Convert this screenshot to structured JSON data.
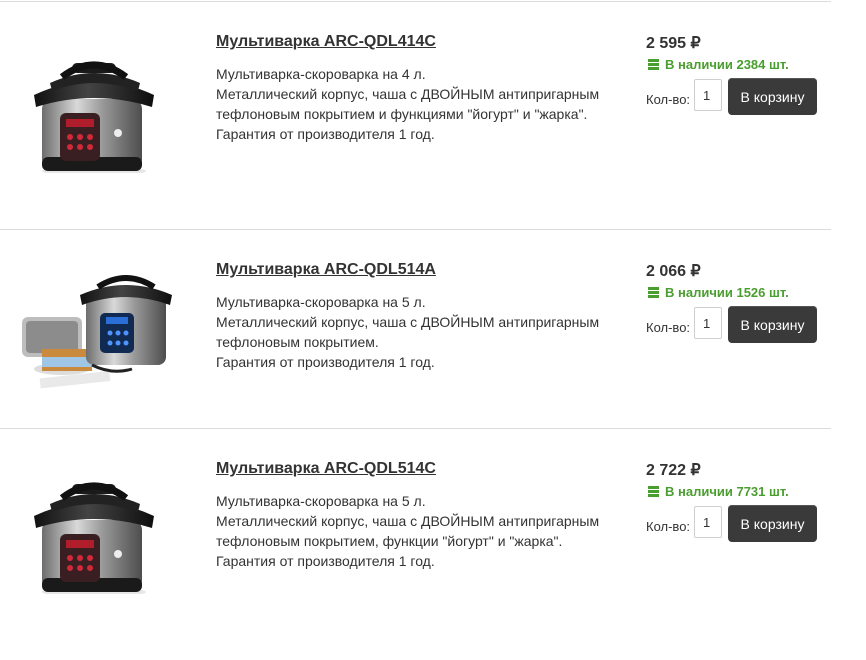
{
  "products": [
    {
      "title": "Мультиварка ARC-QDL414C",
      "image": "pressure-cooker-red-panel",
      "desc": [
        "Мультиварка-скороварка на 4 л.",
        "Металлический корпус, чаша с ДВОЙНЫМ антипригарным",
        "тефлоновым покрытием и функциями \"йогурт\" и \"жарка\".",
        "Гарантия от производителя 1 год."
      ],
      "price": "2 595 ₽",
      "stock": "В наличии 2384 шт.",
      "qty_label": "Кол-во:",
      "qty": "1",
      "cart_label": "В корзину"
    },
    {
      "title": "Мультиварка ARC-QDL514A",
      "image": "pressure-cooker-blue-panel-with-accessories",
      "desc": [
        "Мультиварка-скороварка на 5 л.",
        "Металлический корпус, чаша с ДВОЙНЫМ антипригарным",
        "тефлоновым покрытием.",
        "Гарантия от производителя 1 год."
      ],
      "price": "2 066 ₽",
      "stock": "В наличии 1526 шт.",
      "qty_label": "Кол-во:",
      "qty": "1",
      "cart_label": "В корзину"
    },
    {
      "title": "Мультиварка ARC-QDL514C",
      "image": "pressure-cooker-red-panel",
      "desc": [
        "Мультиварка-скороварка на 5 л.",
        "Металлический корпус, чаша с ДВОЙНЫМ антипригарным",
        "тефлоновым покрытием, функции \"йогурт\" и \"жарка\".",
        "Гарантия от производителя 1 год."
      ],
      "price": "2 722 ₽",
      "stock": "В наличии 7731 шт.",
      "qty_label": "Кол-во:",
      "qty": "1",
      "cart_label": "В корзину"
    }
  ],
  "colors": {
    "stock": "#4a9e2f",
    "button": "#3a3a3a",
    "divider": "#dcdcdc"
  }
}
